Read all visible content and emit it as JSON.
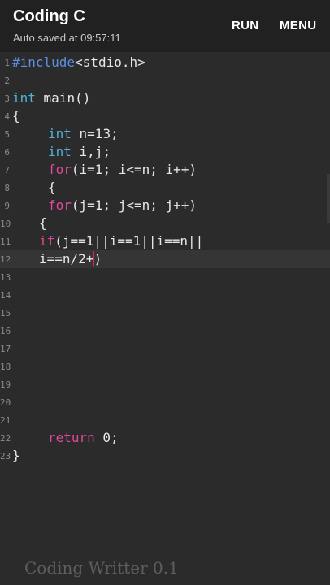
{
  "app": {
    "title": "Coding C",
    "autosave": "Auto saved at 09:57:11",
    "run_label": "RUN",
    "menu_label": "MENU"
  },
  "editor": {
    "line_numbers": [
      "1",
      "2",
      "3",
      "4",
      "5",
      "6",
      "7",
      "8",
      "9",
      "10",
      "11",
      "12",
      "13",
      "14",
      "15",
      "16",
      "17",
      "18",
      "19",
      "20",
      "21",
      "22",
      "23"
    ],
    "lines": {
      "l1": {
        "kw": "#include",
        "rest": "<stdio.h>"
      },
      "l3": {
        "kw": "int",
        "rest": " main()"
      },
      "l4": {
        "text": "{"
      },
      "l5": {
        "kw": "int",
        "rest": " n=13;"
      },
      "l6": {
        "kw": "int",
        "rest": " i,j;"
      },
      "l7": {
        "kw": "for",
        "rest": "(i=1; i<=n; i++)"
      },
      "l8": {
        "text": "{"
      },
      "l9": {
        "kw": "for",
        "rest": "(j=1; j<=n; j++)"
      },
      "l10": {
        "text": "{"
      },
      "l11": {
        "kw": "if",
        "rest": "(j==1||i==1||i==n||"
      },
      "l12": {
        "before": "i==n/2+",
        "after": ")"
      },
      "l22": {
        "kw": "return",
        "rest": " 0;"
      },
      "l23": {
        "text": "}"
      }
    }
  },
  "footer": {
    "watermark": "Coding Writter 0.1"
  },
  "colors": {
    "keyword_pink": "#e0489a",
    "keyword_cyan": "#4fb3d9",
    "preprocessor_blue": "#5c8fe0",
    "caret": "#e02060"
  }
}
